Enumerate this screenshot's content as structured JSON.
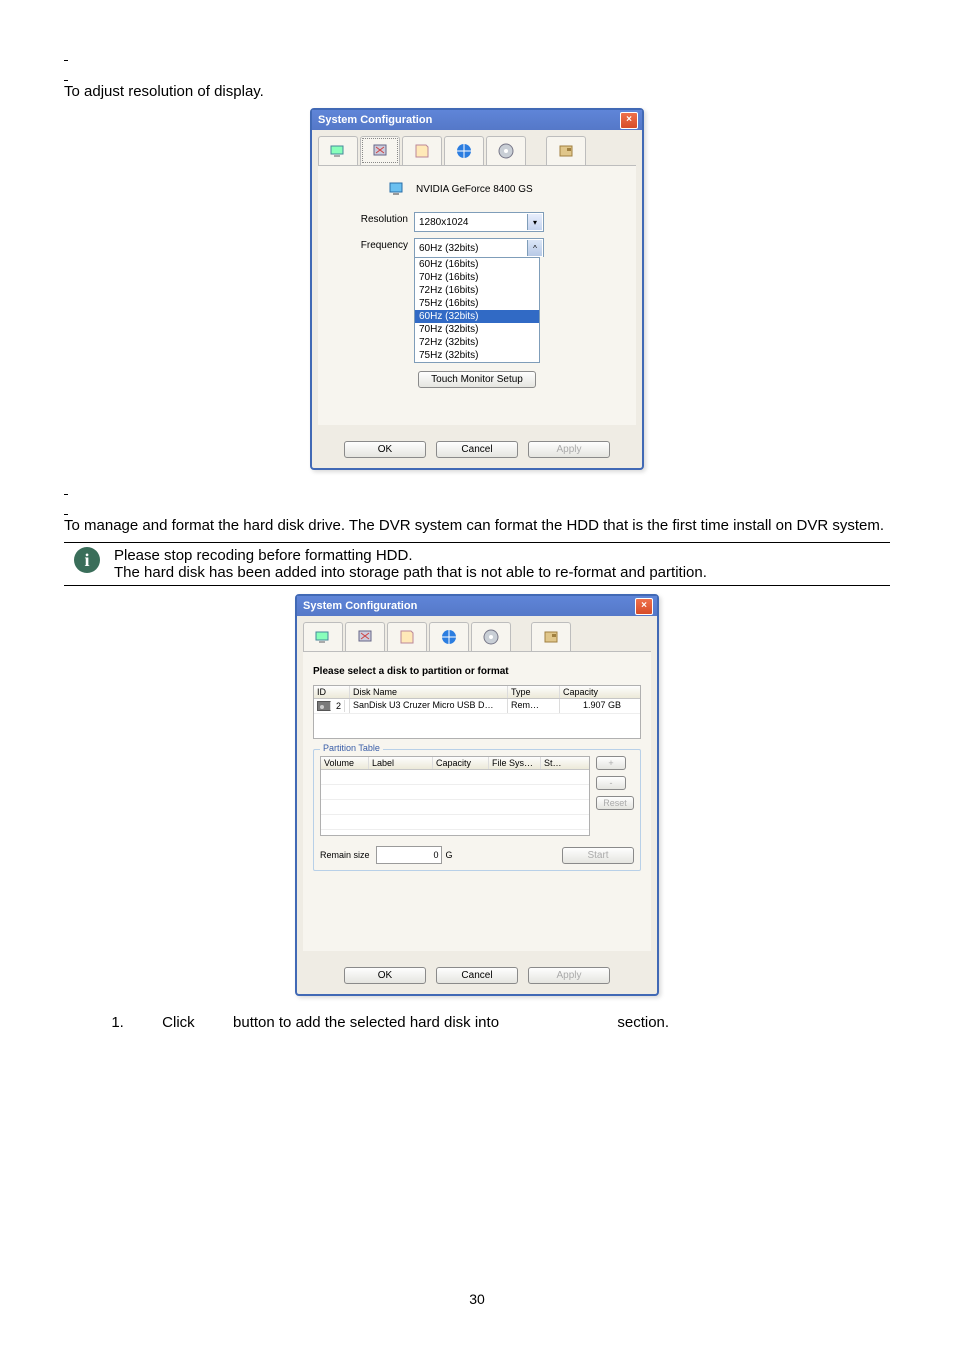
{
  "sections": {
    "display_intro": "To adjust resolution of display.",
    "disk_intro": "To manage and format the hard disk drive. The DVR system can format the HDD that is the first time install on DVR system.",
    "info_line1": "Please stop recoding before formatting HDD.",
    "info_line2": "The hard disk has been added into storage path that is not able to re-format and partition.",
    "step1_a": "Click",
    "step1_b": "button to add the selected hard disk into",
    "step1_c": "section."
  },
  "win1": {
    "title": "System Configuration",
    "video_name": "NVIDIA GeForce 8400 GS",
    "res_label": "Resolution",
    "res_value": "1280x1024",
    "freq_label": "Frequency",
    "freq_value": "60Hz (32bits)",
    "freq_options": [
      "60Hz (16bits)",
      "70Hz (16bits)",
      "72Hz (16bits)",
      "75Hz (16bits)",
      "60Hz (32bits)",
      "70Hz (32bits)",
      "72Hz (32bits)",
      "75Hz (32bits)"
    ],
    "touch_btn": "Touch Monitor Setup",
    "ok": "OK",
    "cancel": "Cancel",
    "apply": "Apply"
  },
  "win2": {
    "title": "System Configuration",
    "heading": "Please select a disk to partition or format",
    "disk_headers": [
      "ID",
      "Disk Name",
      "Type",
      "Capacity"
    ],
    "disk_row": {
      "id": "2",
      "name": "SanDisk U3 Cruzer Micro USB D…",
      "type": "Rem…",
      "cap": "1.907 GB"
    },
    "pt_title": "Partition Table",
    "pt_headers": [
      "Volume",
      "Label",
      "Capacity",
      "File Sys…",
      "St…"
    ],
    "plus": "+",
    "minus": "-",
    "reset": "Reset",
    "remain_label": "Remain size",
    "remain_val": "0",
    "remain_unit": "G",
    "start": "Start",
    "ok": "OK",
    "cancel": "Cancel",
    "apply": "Apply"
  },
  "page_number": "30"
}
